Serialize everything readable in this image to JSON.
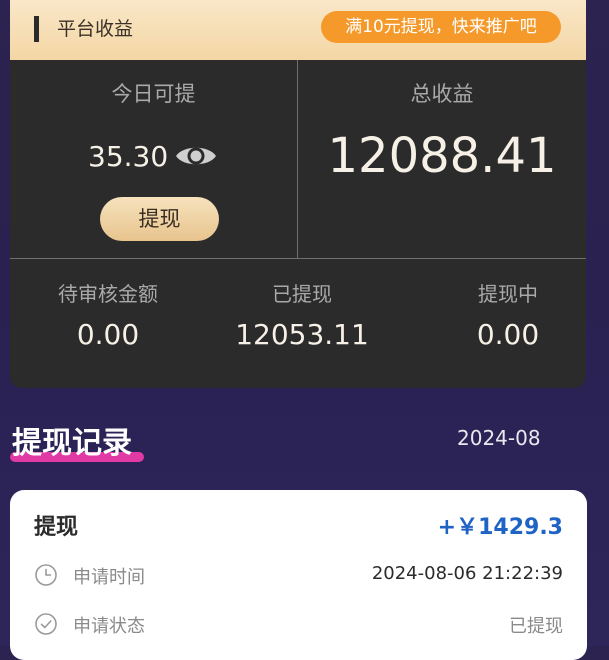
{
  "earnings": {
    "header_title": "平台收益",
    "promo_badge": "满10元提现，快来推广吧",
    "today_withdrawable_label": "今日可提",
    "today_withdrawable_value": "35.30",
    "total_earnings_label": "总收益",
    "total_earnings_value": "12088.41",
    "withdraw_button": "提现",
    "stats": [
      {
        "label": "待审核金额",
        "value": "0.00"
      },
      {
        "label": "已提现",
        "value": "12053.11"
      },
      {
        "label": "提现中",
        "value": "0.00"
      }
    ]
  },
  "records": {
    "title": "提现记录",
    "month": "2024-08",
    "items": [
      {
        "type": "提现",
        "amount": "+￥1429.3",
        "time_label": "申请时间",
        "time_value": "2024-08-06 21:22:39",
        "status_label": "申请状态",
        "status_value": "已提现"
      }
    ]
  },
  "colors": {
    "page_background": "#2b2252",
    "card_background": "#2b2b2b",
    "header_gold": "#f6dcb0",
    "promo_orange": "#f59a2a",
    "underline_pink": "#e13aa4",
    "amount_blue": "#1f63c4"
  },
  "icons": [
    "eye-icon",
    "clock-icon",
    "check-circle-icon"
  ]
}
